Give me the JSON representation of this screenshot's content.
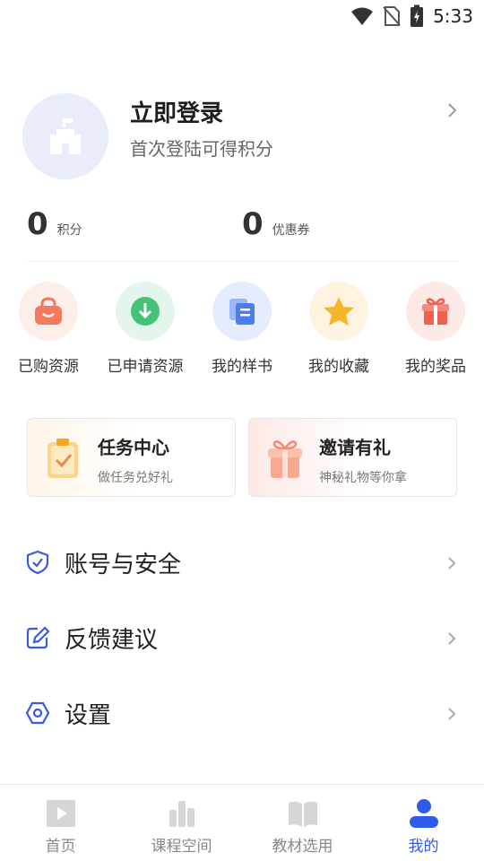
{
  "status_bar": {
    "time": "5:33"
  },
  "profile": {
    "title": "立即登录",
    "subtitle": "首次登陆可得积分"
  },
  "stats": [
    {
      "value": "0",
      "label": "积分"
    },
    {
      "value": "0",
      "label": "优惠券"
    }
  ],
  "shortcuts": [
    {
      "label": "已购资源",
      "icon": "shopping-bag-icon",
      "color": "#f47a5e"
    },
    {
      "label": "已申请资源",
      "icon": "download-icon",
      "color": "#43c27a"
    },
    {
      "label": "我的样书",
      "icon": "book-icon",
      "color": "#4b7df2"
    },
    {
      "label": "我的收藏",
      "icon": "star-icon",
      "color": "#f7b52a"
    },
    {
      "label": "我的奖品",
      "icon": "gift-icon",
      "color": "#f2614f"
    }
  ],
  "cards": [
    {
      "title": "任务中心",
      "subtitle": "做任务兑好礼",
      "icon": "clipboard-icon"
    },
    {
      "title": "邀请有礼",
      "subtitle": "神秘礼物等你拿",
      "icon": "gift-box-icon"
    }
  ],
  "menu": [
    {
      "label": "账号与安全",
      "icon": "shield-icon"
    },
    {
      "label": "反馈建议",
      "icon": "edit-icon"
    },
    {
      "label": "设置",
      "icon": "settings-icon"
    }
  ],
  "bottom_nav": [
    {
      "label": "首页",
      "icon": "play-icon",
      "active": false
    },
    {
      "label": "课程空间",
      "icon": "chart-bars-icon",
      "active": false
    },
    {
      "label": "教材选用",
      "icon": "open-book-icon",
      "active": false
    },
    {
      "label": "我的",
      "icon": "person-icon",
      "active": true
    }
  ],
  "colors": {
    "accent": "#2f5bea",
    "avatar_bg": "#e8ecfb"
  }
}
